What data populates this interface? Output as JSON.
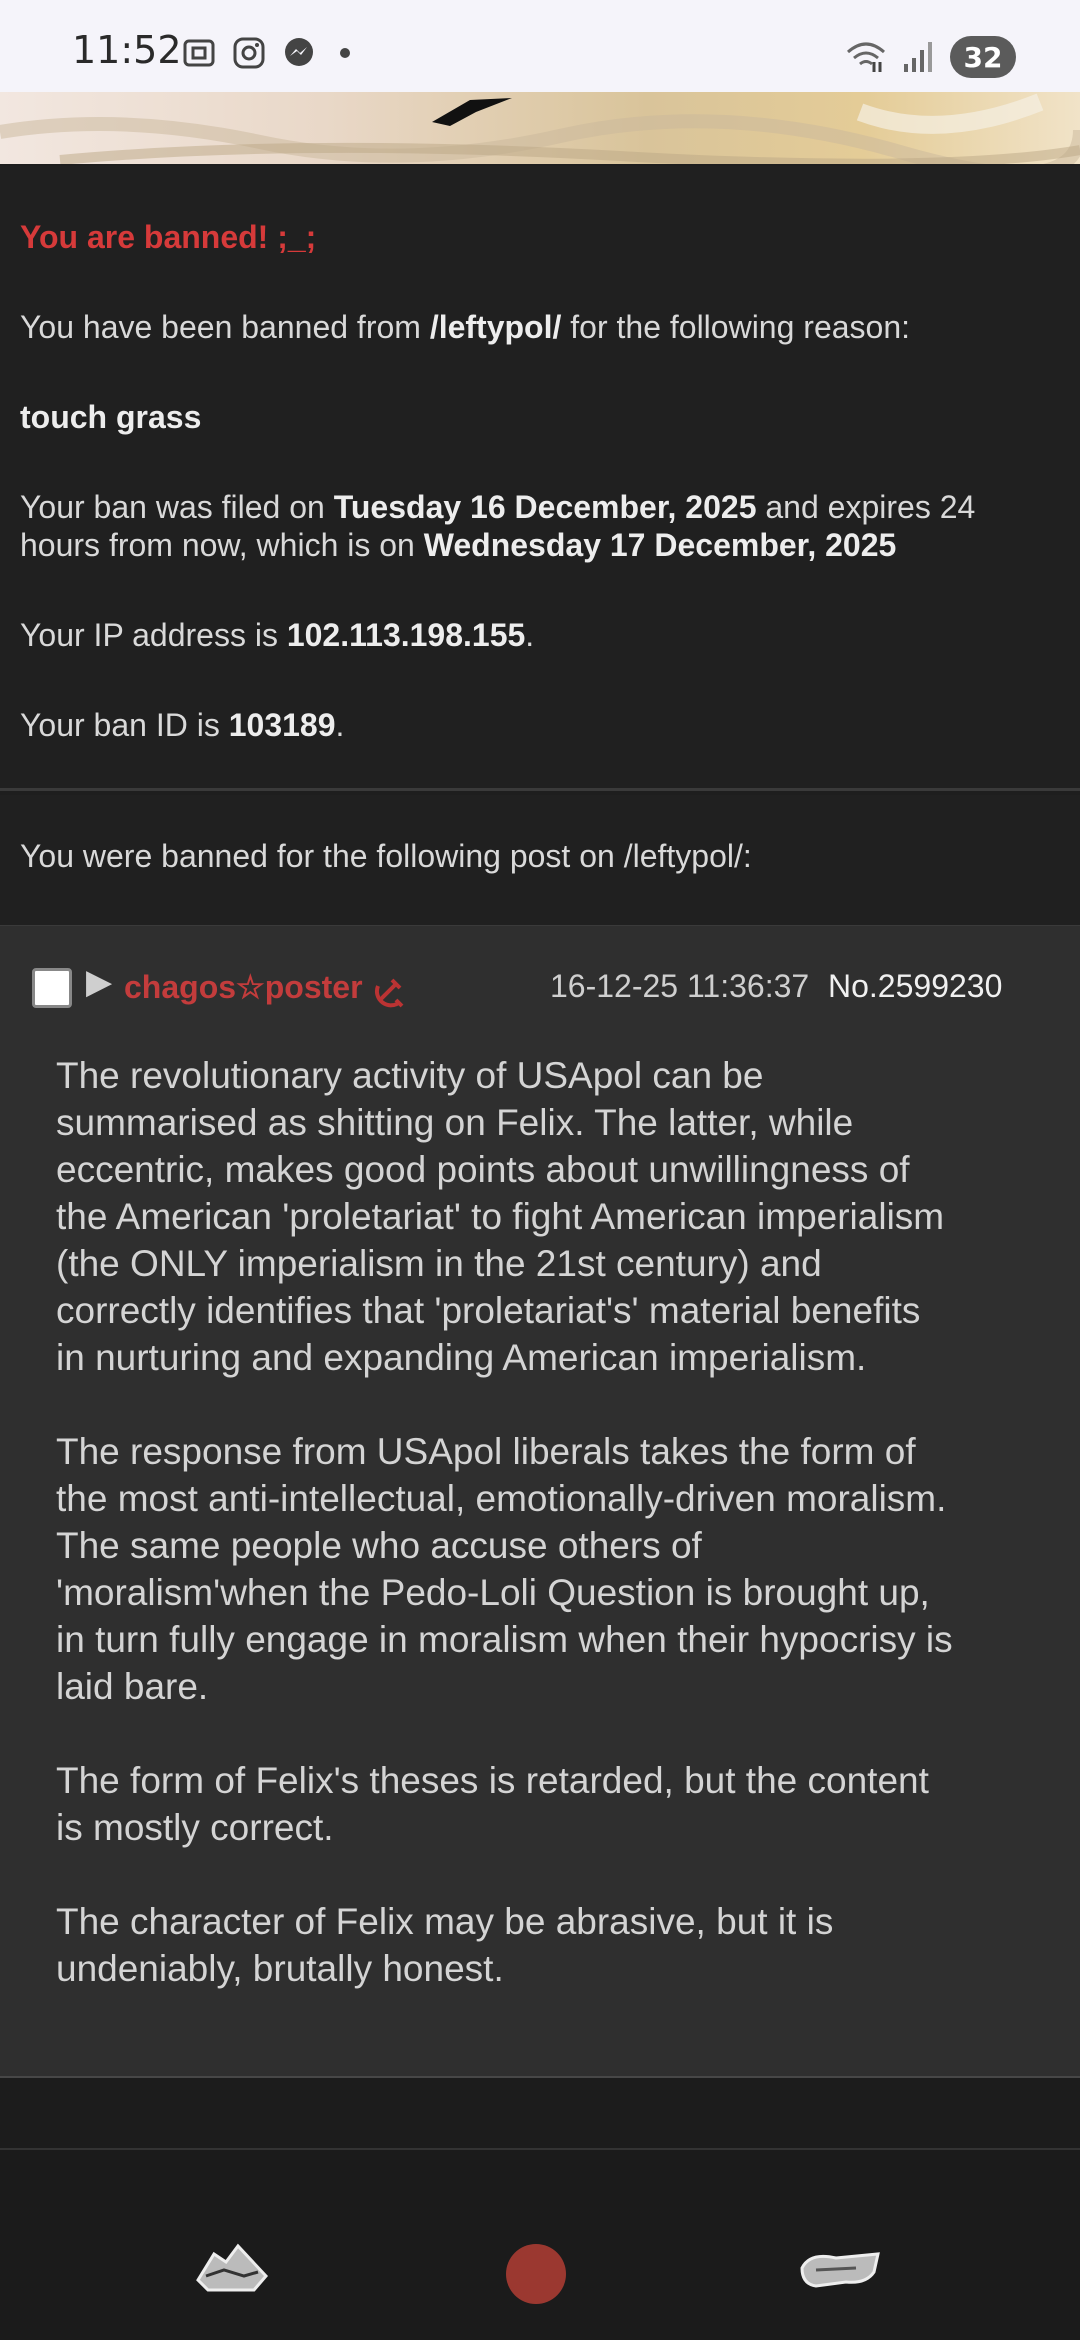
{
  "status_bar": {
    "time": "11:52",
    "battery": "32",
    "icons": [
      "screenshot-icon",
      "instagram-icon",
      "messenger-icon",
      "wifi-icon",
      "signal-icon"
    ]
  },
  "ban": {
    "title": "You are banned! ;_;",
    "reason_intro_pre": "You have been banned from ",
    "board": "/leftypol/",
    "reason_intro_post": " for the following reason:",
    "reason": "touch grass",
    "filed_pre": "Your ban was filed on ",
    "filed_date": "Tuesday 16 December, 2025",
    "filed_mid": " and expires 24",
    "filed_line2_pre": "hours from now, which is on ",
    "expires_date": "Wednesday 17 December, 2025",
    "ip_pre": "Your IP address is ",
    "ip": "102.113.198.155",
    "ip_post": ".",
    "banid_pre": "Your ban ID is ",
    "banid": "103189",
    "banid_post": "."
  },
  "post_intro": "You were banned for the following post on /leftypol/:",
  "post": {
    "arrow": "▶",
    "name": "chagos☆poster",
    "datetime": "16-12-25 11:36:37",
    "number": "No.2599230",
    "paragraphs": [
      "The revolutionary activity of USApol can be summarised as shitting on Felix. The latter, while eccentric, makes good points about unwillingness of the American 'proletariat' to fight American imperialism (the ONLY imperialism in the 21st century) and correctly identifies that 'proletariat's' material benefits in nurturing and expanding American imperialism.",
      "The response from USApol liberals takes the form of the most anti-intellectual, emotionally-driven moralism. The same people who accuse others of 'moralism'when the Pedo-Loli Question is brought up, in turn fully engage in moralism when their hypocrisy is laid bare.",
      "The form of Felix's theses is retarded, but the content is mostly correct.",
      "The character of Felix may be abrasive, but it is undeniably, brutally honest."
    ]
  },
  "colors": {
    "banned_red": "#d63a3a",
    "name_red": "#c33c3c",
    "background": "#1e1e1e",
    "post_bg": "#2f2f2f"
  }
}
